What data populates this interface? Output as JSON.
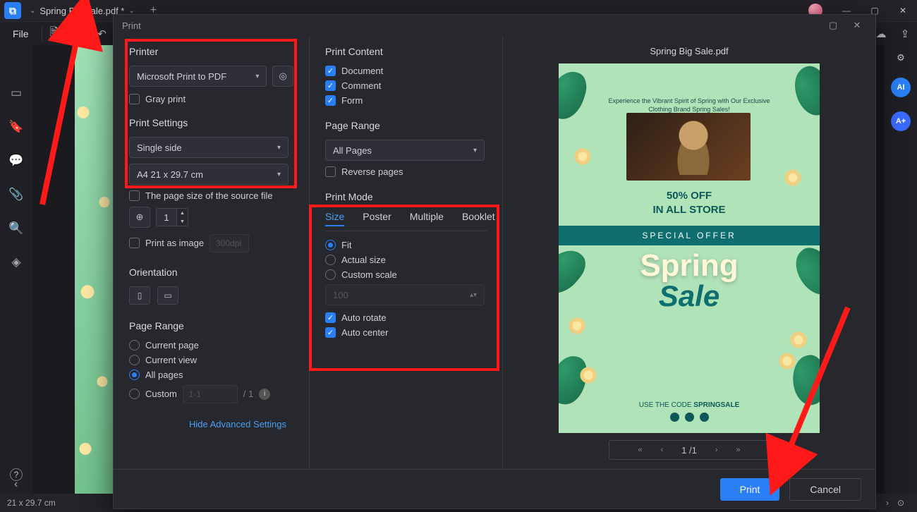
{
  "titlebar": {
    "filename": "Spring Big Sale.pdf *",
    "newtab": "+"
  },
  "filemenu": {
    "label": "File"
  },
  "dialog": {
    "title": "Print",
    "printer_section": "Printer",
    "printer_value": "Microsoft Print to PDF",
    "gray_print": "Gray print",
    "print_settings": "Print Settings",
    "sides_value": "Single side",
    "paper_value": "A4 21 x 29.7 cm",
    "source_size": "The page size of the source file",
    "copies": "1",
    "print_as_image": "Print as image",
    "dpi_placeholder": "300dpi",
    "orientation": "Orientation",
    "left_page_range": "Page Range",
    "pr_current_page": "Current page",
    "pr_current_view": "Current view",
    "pr_all_pages": "All pages",
    "pr_custom": "Custom",
    "pr_custom_ph": "1-1",
    "pr_custom_total": "/ 1",
    "hide_advanced": "Hide Advanced Settings",
    "print_content": "Print Content",
    "pc_document": "Document",
    "pc_comment": "Comment",
    "pc_form": "Form",
    "right_page_range": "Page Range",
    "pr_select": "All Pages",
    "reverse_pages": "Reverse pages",
    "print_mode": "Print Mode",
    "tabs": {
      "size": "Size",
      "poster": "Poster",
      "multiple": "Multiple",
      "booklet": "Booklet"
    },
    "pm_fit": "Fit",
    "pm_actual": "Actual size",
    "pm_custom": "Custom scale",
    "pm_scale_ph": "100",
    "pm_auto_rotate": "Auto rotate",
    "pm_auto_center": "Auto center",
    "preview_title": "Spring Big Sale.pdf",
    "preview": {
      "hero_txt": "Experience the Vibrant Spirit of Spring with Our Exclusive Clothing Brand Spring Sales!",
      "promo_line1": "50% OFF",
      "promo_line2": "IN ALL STORE",
      "band": "SPECIAL OFFER",
      "spring": "Spring",
      "sale": "Sale",
      "use_code_pre": "USE THE CODE ",
      "use_code_code": "SPRINGSALE"
    },
    "pager": {
      "current": "1",
      "sep": "/",
      "total": "1"
    },
    "buttons": {
      "print": "Print",
      "cancel": "Cancel"
    }
  },
  "statusbar": {
    "size": "21 x 29.7 cm"
  }
}
